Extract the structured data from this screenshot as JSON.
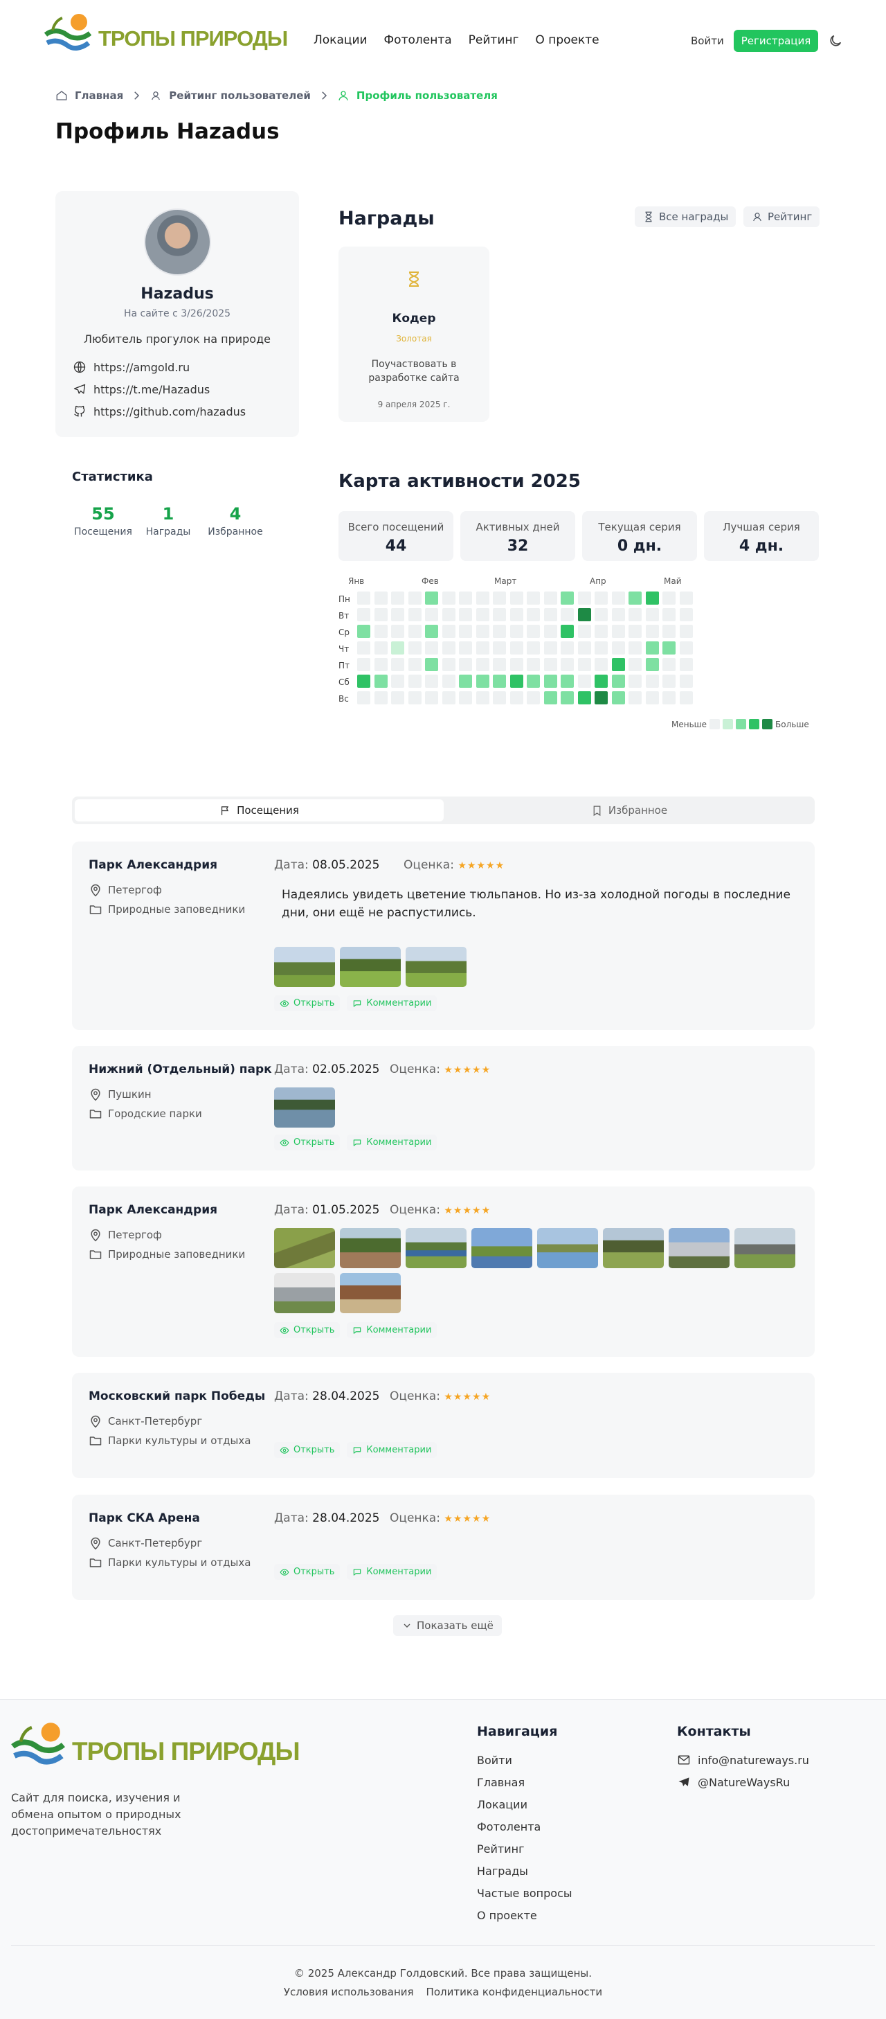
{
  "header": {
    "logo_text": "ТРОПЫ ПРИРОДЫ",
    "nav": [
      "Локации",
      "Фотолента",
      "Рейтинг",
      "О проекте"
    ],
    "login": "Войти",
    "register": "Регистрация"
  },
  "breadcrumbs": [
    "Главная",
    "Рейтинг пользователей",
    "Профиль пользователя"
  ],
  "page_title": "Профиль Hazadus",
  "profile": {
    "username": "Hazadus",
    "since": "На сайте с 3/26/2025",
    "bio": "Любитель прогулок на природе",
    "links": [
      "https://amgold.ru",
      "https://t.me/Hazadus",
      "https://github.com/hazadus"
    ]
  },
  "stats": {
    "title": "Статистика",
    "items": [
      {
        "value": "55",
        "label": "Посещения"
      },
      {
        "value": "1",
        "label": "Награды"
      },
      {
        "value": "4",
        "label": "Избранное"
      }
    ]
  },
  "awards": {
    "title": "Награды",
    "all_btn": "Все награды",
    "rating_btn": "Рейтинг",
    "items": [
      {
        "name": "Кодер",
        "tier": "Золотая",
        "desc": "Поучаствовать в разработке сайта",
        "date": "9 апреля 2025 г."
      }
    ]
  },
  "activity": {
    "title": "Карта активности 2025",
    "cards": [
      {
        "label": "Всего посещений",
        "value": "44"
      },
      {
        "label": "Активных дней",
        "value": "32"
      },
      {
        "label": "Текущая серия",
        "value": "0 дн."
      },
      {
        "label": "Лучшая серия",
        "value": "4 дн."
      }
    ],
    "months": [
      "Янв",
      "Фев",
      "Март",
      "Апр",
      "Май"
    ],
    "days": [
      "Пн",
      "Вт",
      "Ср",
      "Чт",
      "Пт",
      "Сб",
      "Вс"
    ],
    "legend_less": "Меньше",
    "legend_more": "Больше",
    "grid": [
      [
        0,
        0,
        0,
        0,
        2,
        0,
        0,
        0,
        0,
        0,
        0,
        0,
        2,
        0,
        0,
        0,
        2,
        3,
        0,
        0
      ],
      [
        0,
        0,
        0,
        0,
        0,
        0,
        0,
        0,
        0,
        0,
        0,
        0,
        0,
        4,
        0,
        0,
        0,
        0,
        0,
        0
      ],
      [
        2,
        0,
        0,
        0,
        2,
        0,
        0,
        0,
        0,
        0,
        0,
        0,
        3,
        0,
        0,
        0,
        0,
        0,
        0,
        0
      ],
      [
        0,
        0,
        1,
        0,
        0,
        0,
        0,
        0,
        0,
        0,
        0,
        0,
        0,
        0,
        0,
        0,
        0,
        2,
        2,
        0
      ],
      [
        0,
        0,
        0,
        0,
        2,
        0,
        0,
        0,
        0,
        0,
        0,
        0,
        0,
        0,
        0,
        3,
        0,
        2,
        0,
        0
      ],
      [
        3,
        2,
        0,
        0,
        0,
        0,
        2,
        2,
        2,
        3,
        2,
        2,
        2,
        0,
        3,
        2,
        0,
        0,
        0,
        0
      ],
      [
        0,
        0,
        0,
        0,
        0,
        0,
        0,
        0,
        0,
        0,
        0,
        2,
        2,
        3,
        4,
        2,
        0,
        0,
        0,
        0
      ]
    ],
    "colors": [
      "#eef1f2",
      "#c9f1d6",
      "#7ee0a2",
      "#2fc265",
      "#1e8a45"
    ]
  },
  "tabs": {
    "visits": "Посещения",
    "favorites": "Избранное"
  },
  "labels": {
    "date": "Дата:",
    "rating": "Оценка:",
    "open": "Открыть",
    "comments": "Комментарии",
    "stars": "★★★★★"
  },
  "visits": [
    {
      "name": "Парк Александрия",
      "city": "Петергоф",
      "category": "Природные заповедники",
      "date": "08.05.2025",
      "text": "Надеялись увидеть цветение тюльпанов. Но из-за холодной погоды в последние дни, они ещё не распустились.",
      "photos": 3
    },
    {
      "name": "Нижний (Отдельный) парк",
      "city": "Пушкин",
      "category": "Городские парки",
      "date": "02.05.2025",
      "text": "",
      "photos": 1
    },
    {
      "name": "Парк Александрия",
      "city": "Петергоф",
      "category": "Природные заповедники",
      "date": "01.05.2025",
      "text": "",
      "photos": 10
    },
    {
      "name": "Московский парк Победы",
      "city": "Санкт-Петербург",
      "category": "Парки культуры и отдыха",
      "date": "28.04.2025",
      "text": "",
      "photos": 0
    },
    {
      "name": "Парк СКА Арена",
      "city": "Санкт-Петербург",
      "category": "Парки культуры и отдыха",
      "date": "28.04.2025",
      "text": "",
      "photos": 0
    }
  ],
  "show_more": "Показать ещё",
  "footer": {
    "desc": "Сайт для поиска, изучения и обмена опытом о природных достопримечательностях",
    "nav_title": "Навигация",
    "nav": [
      "Войти",
      "Главная",
      "Локации",
      "Фотолента",
      "Рейтинг",
      "Награды",
      "Частые вопросы",
      "О проекте"
    ],
    "contacts_title": "Контакты",
    "email": "info@natureways.ru",
    "telegram": "@NatureWaysRu",
    "copyright": "© 2025 Александр Голдовский. Все права защищены.",
    "terms": "Условия использования",
    "privacy": "Политика конфиденциальности"
  }
}
